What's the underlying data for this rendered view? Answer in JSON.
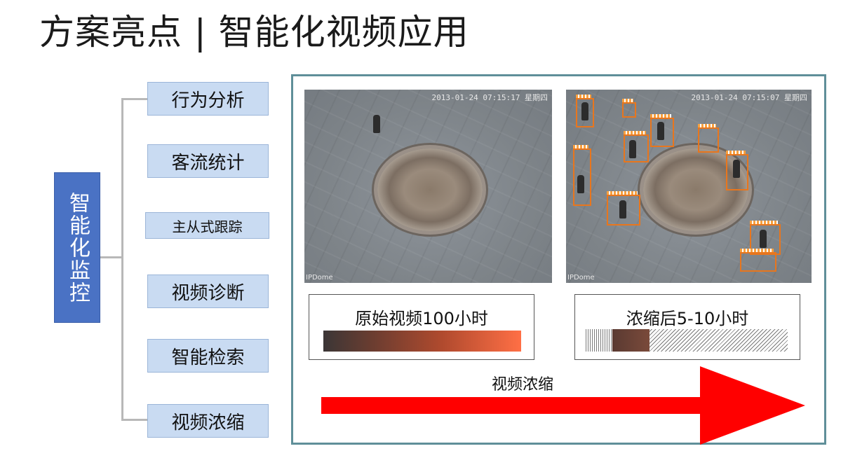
{
  "title": "方案亮点 | 智能化视频应用",
  "tree": {
    "root": "智能化监控",
    "items": [
      {
        "label": "行为分析"
      },
      {
        "label": "客流统计"
      },
      {
        "label": "主从式跟踪"
      },
      {
        "label": "视频诊断"
      },
      {
        "label": "智能检索"
      },
      {
        "label": "视频浓缩"
      }
    ]
  },
  "panel": {
    "cam_left": {
      "timestamp": "2013-01-24 07:15:17 星期四",
      "brand": "IPDome"
    },
    "cam_right": {
      "timestamp": "2013-01-24 07:15:07 星期四",
      "brand": "IPDome"
    },
    "original_label": "原始视频100小时",
    "condensed_label": "浓缩后5-10小时",
    "arrow_label": "视频浓缩",
    "colors": {
      "arrow": "#ff0000",
      "border": "#5f8f99",
      "box": "#e8761d"
    }
  }
}
